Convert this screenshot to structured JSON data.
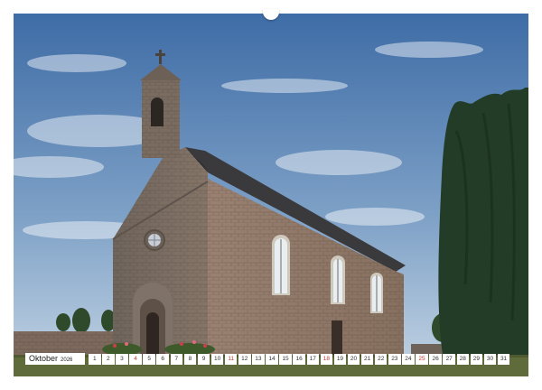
{
  "calendar": {
    "month": "Oktober",
    "year": "2026",
    "days": [
      "1",
      "2",
      "3",
      "4",
      "5",
      "6",
      "7",
      "8",
      "9",
      "10",
      "11",
      "12",
      "13",
      "14",
      "15",
      "16",
      "17",
      "18",
      "19",
      "20",
      "21",
      "22",
      "23",
      "24",
      "25",
      "26",
      "27",
      "28",
      "29",
      "30",
      "31"
    ],
    "sundays": [
      "4",
      "11",
      "18",
      "25"
    ]
  },
  "colors": {
    "sky_top": "#3f6fa8",
    "sky_bottom": "#b9cde0",
    "stone": "#8a7668",
    "roof": "#3b3b3e",
    "cypress": "#24402a",
    "grass": "#5e6b38",
    "sunday_red": "#c0392b"
  }
}
